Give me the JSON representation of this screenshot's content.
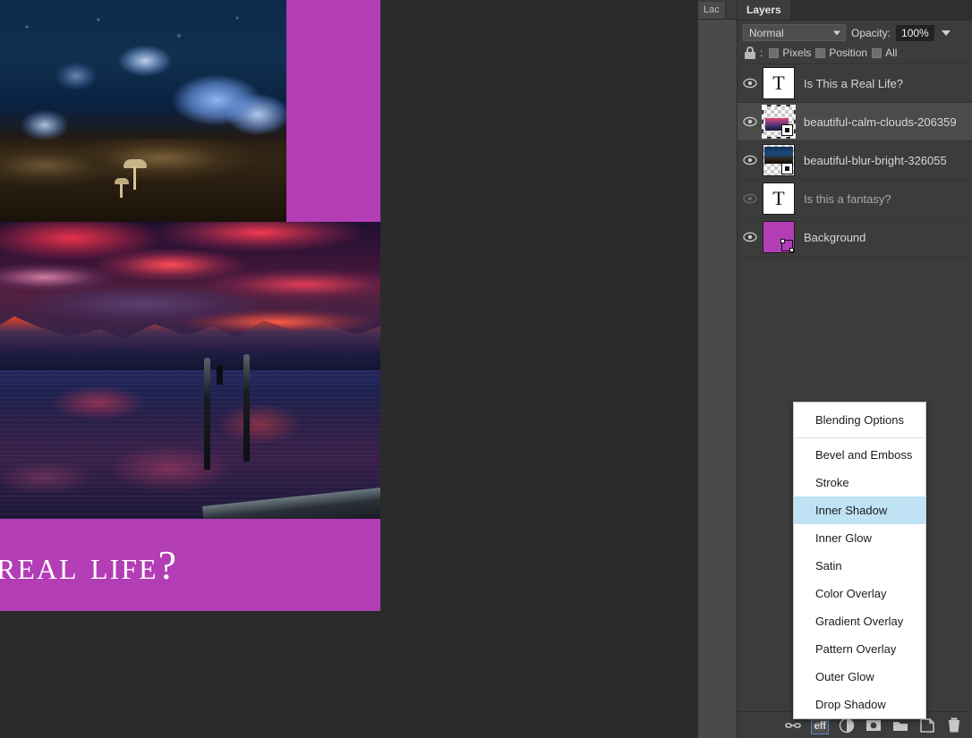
{
  "side_dock": {
    "tab_label": "Lac"
  },
  "layers_panel": {
    "tab_label": "Layers",
    "blend_mode": "Normal",
    "blend_caret_icon": "chevron-down-icon",
    "opacity_label": "Opacity:",
    "opacity_value": "100%",
    "opacity_caret_icon": "chevron-down-icon",
    "lock": {
      "lock_icon": "lock-icon",
      "colon": ":",
      "items": [
        {
          "label": "Pixels"
        },
        {
          "label": "Position"
        },
        {
          "label": "All"
        }
      ]
    },
    "layers": [
      {
        "name": "Is This a Real Life?",
        "kind": "text",
        "visible": true,
        "selected": false
      },
      {
        "name": "beautiful-calm-clouds-206359",
        "kind": "image-mask",
        "visible": true,
        "selected": true
      },
      {
        "name": "beautiful-blur-bright-326055",
        "kind": "image-mask",
        "visible": true,
        "selected": false
      },
      {
        "name": "Is this a fantasy?",
        "kind": "text",
        "visible": false,
        "selected": false
      },
      {
        "name": "Background",
        "kind": "color",
        "visible": true,
        "selected": false
      }
    ],
    "bottom_toolbar": [
      {
        "icon": "link-layers-icon",
        "label": "",
        "active": false
      },
      {
        "icon": "layer-effects-icon",
        "label": "eff",
        "active": true
      },
      {
        "icon": "adjustment-layer-icon",
        "label": "",
        "active": false
      },
      {
        "icon": "layer-mask-icon",
        "label": "",
        "active": false
      },
      {
        "icon": "new-group-icon",
        "label": "",
        "active": false
      },
      {
        "icon": "new-layer-icon",
        "label": "",
        "active": false
      },
      {
        "icon": "delete-layer-icon",
        "label": "",
        "active": false
      }
    ]
  },
  "fx_menu": {
    "items": [
      {
        "label": "Blending Options",
        "highlight": false,
        "separator_after": true
      },
      {
        "label": "Bevel and Emboss",
        "highlight": false
      },
      {
        "label": "Stroke",
        "highlight": false
      },
      {
        "label": "Inner Shadow",
        "highlight": true
      },
      {
        "label": "Inner Glow",
        "highlight": false
      },
      {
        "label": "Satin",
        "highlight": false
      },
      {
        "label": "Color Overlay",
        "highlight": false
      },
      {
        "label": "Gradient Overlay",
        "highlight": false
      },
      {
        "label": "Pattern Overlay",
        "highlight": false
      },
      {
        "label": "Outer Glow",
        "highlight": false
      },
      {
        "label": "Drop Shadow",
        "highlight": false
      }
    ]
  },
  "canvas": {
    "title_text": "Real Life?",
    "background_color": "#b23db5",
    "images": [
      {
        "name": "butterflies-night-forest"
      },
      {
        "name": "mountain-lake-sunset-dock"
      }
    ]
  }
}
